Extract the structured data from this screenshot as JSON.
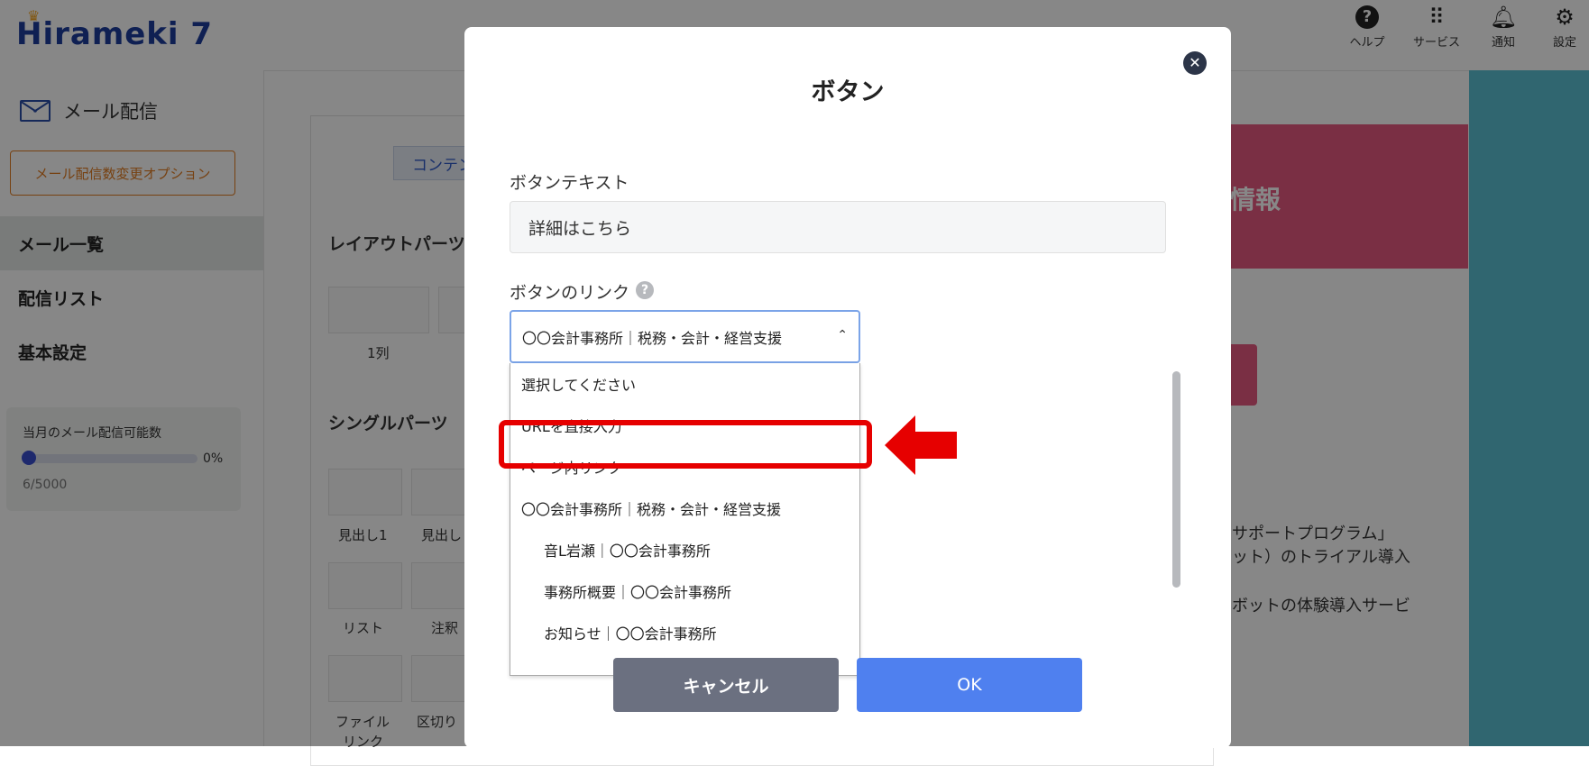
{
  "app": {
    "logo_text": "Hirameki 7"
  },
  "sidebar": {
    "section_title": "メール配信",
    "option_button": "メール配信数変更オプション",
    "items": [
      {
        "label": "メール一覧",
        "active": true
      },
      {
        "label": "配信リスト",
        "active": false
      },
      {
        "label": "基本設定",
        "active": false
      }
    ],
    "quota": {
      "title": "当月のメール配信可能数",
      "percent_label": "0%",
      "progress": 0.0,
      "count": "6/5000"
    }
  },
  "header": {
    "items": [
      {
        "label": "ヘルプ",
        "icon": "help-icon"
      },
      {
        "label": "サービス",
        "icon": "grid-icon"
      },
      {
        "label": "通知",
        "icon": "bell-icon"
      },
      {
        "label": "設定",
        "icon": "gear-icon"
      }
    ]
  },
  "editor": {
    "tab_label": "コンテン",
    "layout_title": "レイアウトパーツ",
    "layout_parts": [
      "1列"
    ],
    "single_title": "シングルパーツ",
    "single_parts": [
      "見出し1",
      "見出し",
      "リスト",
      "注釈",
      "ファイル",
      "区切り"
    ],
    "file_part_line2": "リンク",
    "canvas_heading_fragment": "情報",
    "canvas_lines": [
      "とサポートプログラム」",
      "ボット）のトライアル導入",
      "ロボットの体験導入サービ"
    ]
  },
  "modal": {
    "title": "ボタン",
    "button_text_label": "ボタンテキスト",
    "button_text_value": "詳細はこちら",
    "link_label": "ボタンのリンク",
    "selected_value": "〇〇会計事務所｜税務・会計・経営支援",
    "options": [
      {
        "label": "選択してください",
        "indent": false
      },
      {
        "label": "URLを直接入力",
        "indent": false
      },
      {
        "label": "ページ内リンク",
        "indent": false,
        "highlighted": true
      },
      {
        "label": "〇〇会計事務所｜税務・会計・経営支援",
        "indent": false
      },
      {
        "label": "音L岩瀬｜〇〇会計事務所",
        "indent": true
      },
      {
        "label": "事務所概要｜〇〇会計事務所",
        "indent": true
      },
      {
        "label": "お知らせ｜〇〇会計事務所",
        "indent": true
      }
    ],
    "cancel_label": "キャンセル",
    "ok_label": "OK"
  },
  "colors": {
    "highlight": "#e60000",
    "ok_button": "#4f80ef",
    "cancel_button": "#6b7080",
    "logo": "#1d3d9e",
    "option_button": "#e07b20"
  }
}
